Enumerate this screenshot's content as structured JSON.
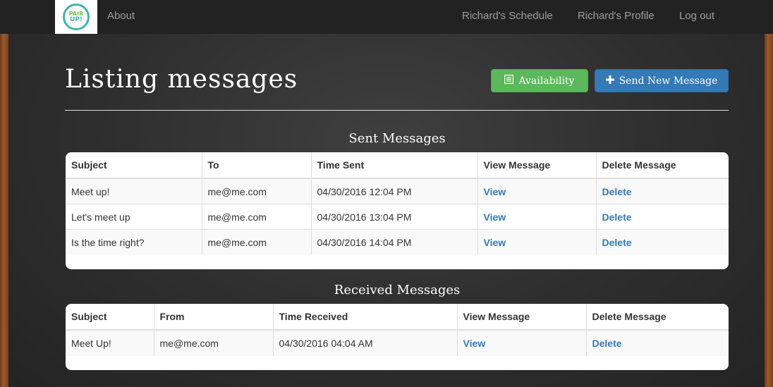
{
  "nav": {
    "logo_line1": "PAIR",
    "logo_line2": "UP!",
    "about": "About",
    "schedule": "Richard's Schedule",
    "profile": "Richard's Profile",
    "logout": "Log out"
  },
  "page": {
    "title": "Listing messages",
    "availability_label": "Availability",
    "send_new_label": "Send New Message"
  },
  "sent": {
    "title": "Sent Messages",
    "headers": [
      "Subject",
      "To",
      "Time Sent",
      "View Message",
      "Delete Message"
    ],
    "rows": [
      {
        "subject": "Meet up!",
        "to": "me@me.com",
        "time": "04/30/2016 12:04 PM",
        "view": "View",
        "delete": "Delete"
      },
      {
        "subject": "Let's meet up",
        "to": "me@me.com",
        "time": "04/30/2016 13:04 PM",
        "view": "View",
        "delete": "Delete"
      },
      {
        "subject": "Is the time right?",
        "to": "me@me.com",
        "time": "04/30/2016 14:04 PM",
        "view": "View",
        "delete": "Delete"
      }
    ]
  },
  "received": {
    "title": "Received Messages",
    "headers": [
      "Subject",
      "From",
      "Time Received",
      "View Message",
      "Delete Message"
    ],
    "rows": [
      {
        "subject": "Meet Up!",
        "from": "me@me.com",
        "time": "04/30/2016 04:04 AM",
        "view": "View",
        "delete": "Delete"
      }
    ]
  },
  "colors": {
    "navbar": "#222222",
    "chalkboard": "#2e2e2e",
    "success": "#5cb85c",
    "primary": "#337ab7",
    "link": "#337ab7"
  },
  "icons": {
    "availability": "list-alt-icon",
    "send_new": "plus-icon"
  }
}
